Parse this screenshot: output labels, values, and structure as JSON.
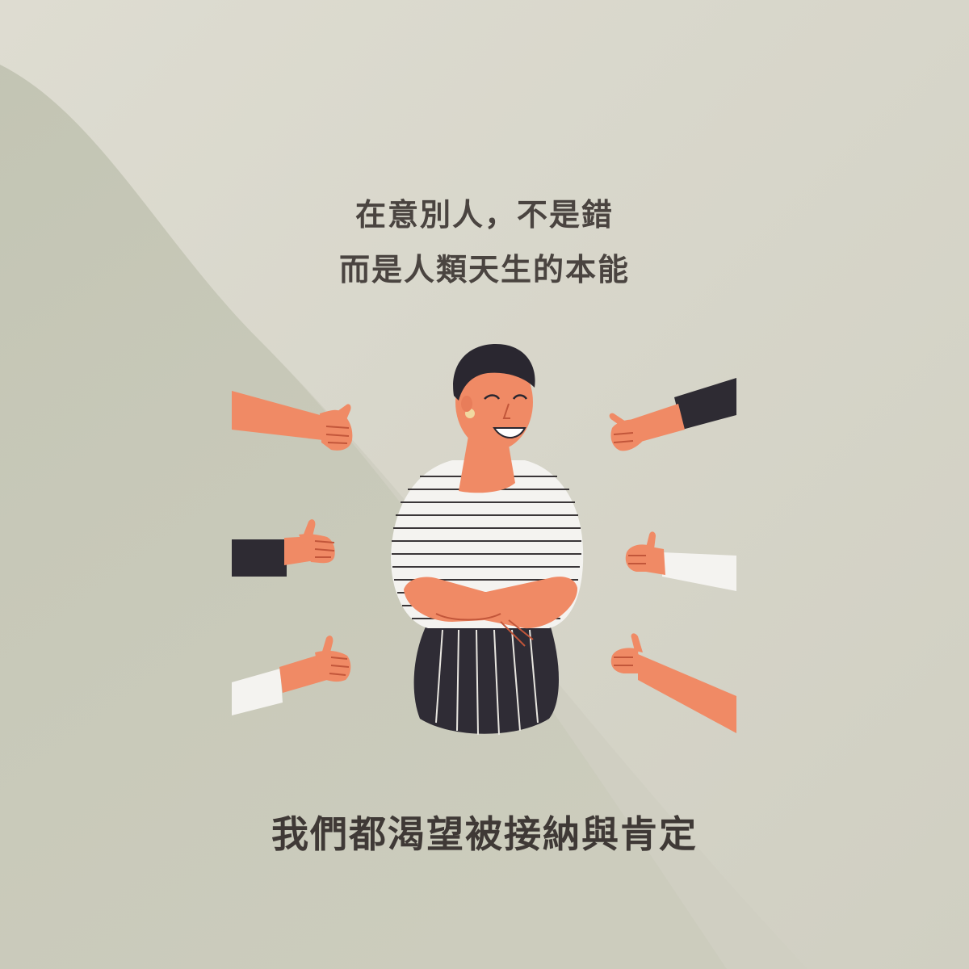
{
  "headline": {
    "line1": "在意別人，不是錯",
    "line2": "而是人類天生的本能"
  },
  "footer": {
    "text": "我們都渴望被接納與肯定"
  },
  "colors": {
    "background": "#d1d0c3",
    "text": "#4a4440",
    "skin": "#f08a65",
    "hair": "#2a2730",
    "sleeve_dark": "#2e2b33",
    "sleeve_white": "#f4f3f0",
    "shirt_stripe": "#3a3638",
    "skirt": "#2f2c35"
  },
  "illustration": {
    "icons": [
      "woman-smiling-icon",
      "thumbs-up-hand-icon"
    ]
  }
}
